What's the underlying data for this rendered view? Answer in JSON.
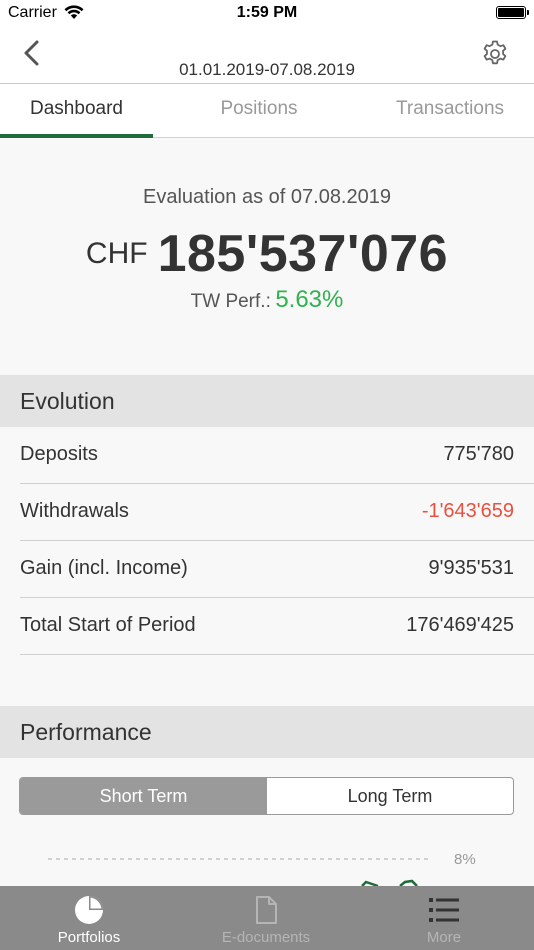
{
  "status": {
    "carrier": "Carrier",
    "time": "1:59 PM"
  },
  "header": {
    "date_range": "01.01.2019-07.08.2019"
  },
  "tabs": [
    {
      "label": "Dashboard",
      "active": true
    },
    {
      "label": "Positions",
      "active": false
    },
    {
      "label": "Transactions",
      "active": false
    }
  ],
  "summary": {
    "evaluation_label": "Evaluation as of 07.08.2019",
    "currency": "CHF",
    "total": "185'537'076",
    "perf_label": "TW Perf.:",
    "perf_value": "5.63%"
  },
  "evolution": {
    "title": "Evolution",
    "rows": [
      {
        "label": "Deposits",
        "value": "775'780"
      },
      {
        "label": "Withdrawals",
        "value": "-1'643'659"
      },
      {
        "label": "Gain (incl. Income)",
        "value": "9'935'531"
      },
      {
        "label": "Total Start of Period",
        "value": "176'469'425"
      }
    ]
  },
  "performance": {
    "title": "Performance",
    "toggle": {
      "short": "Short Term",
      "long": "Long Term",
      "selected": "short"
    },
    "axis_tick": "8%"
  },
  "tabbar": [
    {
      "label": "Portfolios",
      "icon": "pie-chart-icon",
      "active": true
    },
    {
      "label": "E-documents",
      "icon": "document-icon",
      "active": false
    },
    {
      "label": "More",
      "icon": "list-icon",
      "active": false
    }
  ],
  "colors": {
    "accent": "#1f6b3a",
    "positive": "#2fb24f",
    "negative": "#e8513f",
    "tabbar": "#8a8a8a"
  }
}
